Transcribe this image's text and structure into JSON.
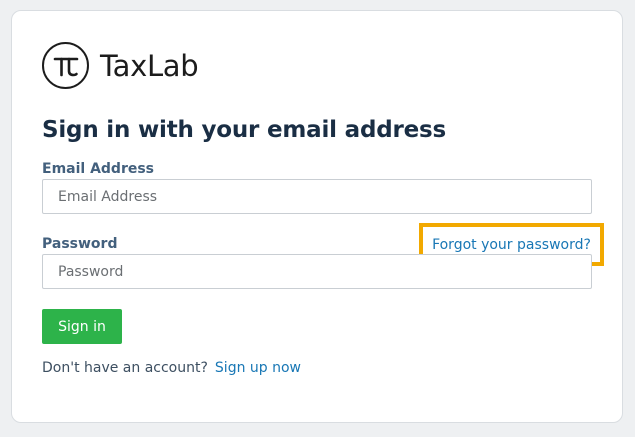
{
  "brand": {
    "name": "TaxLab",
    "icon": "pi-icon"
  },
  "heading": "Sign in with your email address",
  "email": {
    "label": "Email Address",
    "placeholder": "Email Address",
    "value": ""
  },
  "password": {
    "label": "Password",
    "placeholder": "Password",
    "value": ""
  },
  "forgot_password": {
    "text": "Forgot your password?",
    "highlight_color": "#f2a900"
  },
  "sign_in_button": {
    "label": "Sign in",
    "color": "#2db34a"
  },
  "signup": {
    "prompt": "Don't have an account?",
    "link_text": "Sign up now"
  },
  "colors": {
    "heading": "#1a2e44",
    "label": "#43607d",
    "link": "#1877b5",
    "background": "#eef0f2"
  }
}
